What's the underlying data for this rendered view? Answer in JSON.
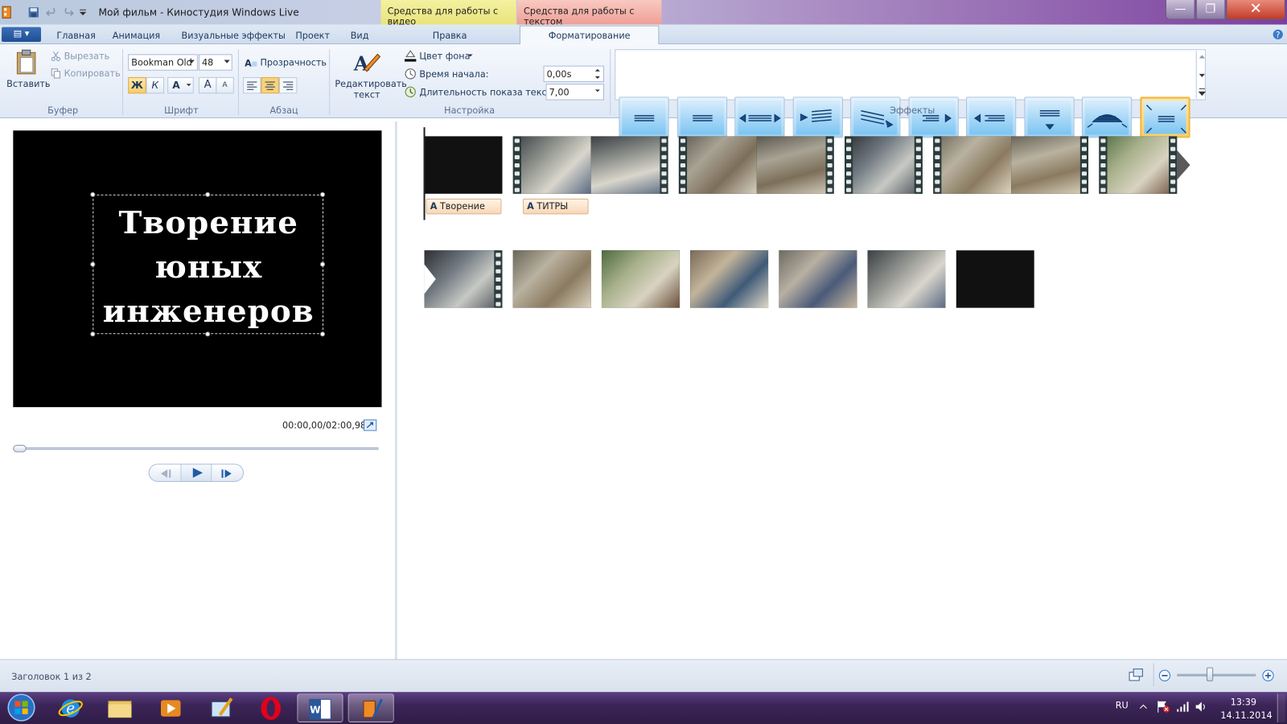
{
  "window": {
    "title": "Мой фильм - Киностудия Windows Live",
    "minimize_glyph": "—",
    "maximize_glyph": "❐",
    "close_glyph": "✕"
  },
  "contextual_tabs": {
    "video_tools": "Средства для работы с видео",
    "text_tools": "Средства для работы с текстом"
  },
  "tabs": {
    "file_menu": "▤ ▾",
    "items": [
      "Главная",
      "Анимация",
      "Визуальные эффекты",
      "Проект",
      "Вид",
      "Правка",
      "Форматирование"
    ],
    "active": "Форматирование"
  },
  "ribbon": {
    "clipboard": {
      "group_label": "Буфер",
      "paste": "Вставить",
      "cut": "Вырезать",
      "copy": "Копировать"
    },
    "font": {
      "group_label": "Шрифт",
      "font_name": "Bookman Old",
      "font_size": "48",
      "bold": "Ж",
      "italic": "К",
      "font_color": "A",
      "grow": "A",
      "shrink": "A",
      "transparency": "Прозрачность"
    },
    "paragraph": {
      "group_label": "Абзац"
    },
    "settings": {
      "group_label": "Настройка",
      "edit_text": "Редактировать текст",
      "background_color": "Цвет фона",
      "start_time_label": "Время начала:",
      "start_time_value": "0,00s",
      "duration_label": "Длительность показа текста:",
      "duration_value": "7,00"
    },
    "effects": {
      "group_label": "Эффекты",
      "count": 10,
      "selected_index": 9
    }
  },
  "preview": {
    "title_lines": [
      "Творение",
      "юных",
      "инженеров"
    ],
    "timecode": "00:00,00/02:00,98",
    "progress": 0
  },
  "storyboard": {
    "captions": [
      "Творение",
      "ТИТРЫ"
    ],
    "caption_icon": "A"
  },
  "status": {
    "text": "Заголовок 1 из 2",
    "zoom_level": 0.4
  },
  "taskbar": {
    "language": "RU",
    "time": "13:39",
    "date": "14.11.2014"
  },
  "colors": {
    "accent": "#1e395b",
    "selected_effect": "#f0b63c",
    "video_tools_tab": "#e9e37c",
    "text_tools_tab": "#ef9f95"
  }
}
